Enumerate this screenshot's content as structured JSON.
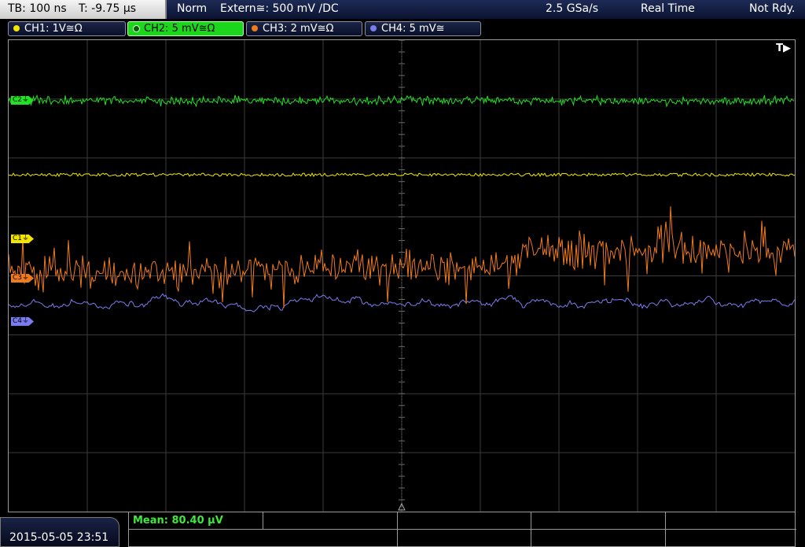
{
  "status": {
    "timebase": "TB: 100 ns",
    "trigger_time": "T: -9.75 µs",
    "mode": "Norm",
    "trigger_source": "Extern≅: 500 mV ∕DC",
    "sample_rate": "2.5 GSa/s",
    "acq_mode": "Real Time",
    "state": "Not Rdy."
  },
  "channels": [
    {
      "label": "CH1: 1V≅Ω",
      "color": "#f2e600",
      "active": false
    },
    {
      "label": "CH2: 5 mV≅Ω",
      "color": "#22e022",
      "active": true
    },
    {
      "label": "CH3: 2 mV≅Ω",
      "color": "#f07a1e",
      "active": false
    },
    {
      "label": "CH4: 5 mV≅",
      "color": "#7b7bf0",
      "active": false
    }
  ],
  "markers": {
    "c1": "C1⏚",
    "c2": "C2⏚",
    "c3": "C3⏚",
    "c4": "C4⏚"
  },
  "trigger_indicator": "T▶",
  "measurement": {
    "mean": "Mean: 80.40 µV"
  },
  "datetime": "2015-05-05 23:51",
  "colors": {
    "ch1": "#f2e600",
    "ch2": "#22e022",
    "ch3": "#f07a1e",
    "ch4": "#7b7bf0",
    "grid": "#3b3b3b",
    "frame": "#9a9a9a"
  }
}
